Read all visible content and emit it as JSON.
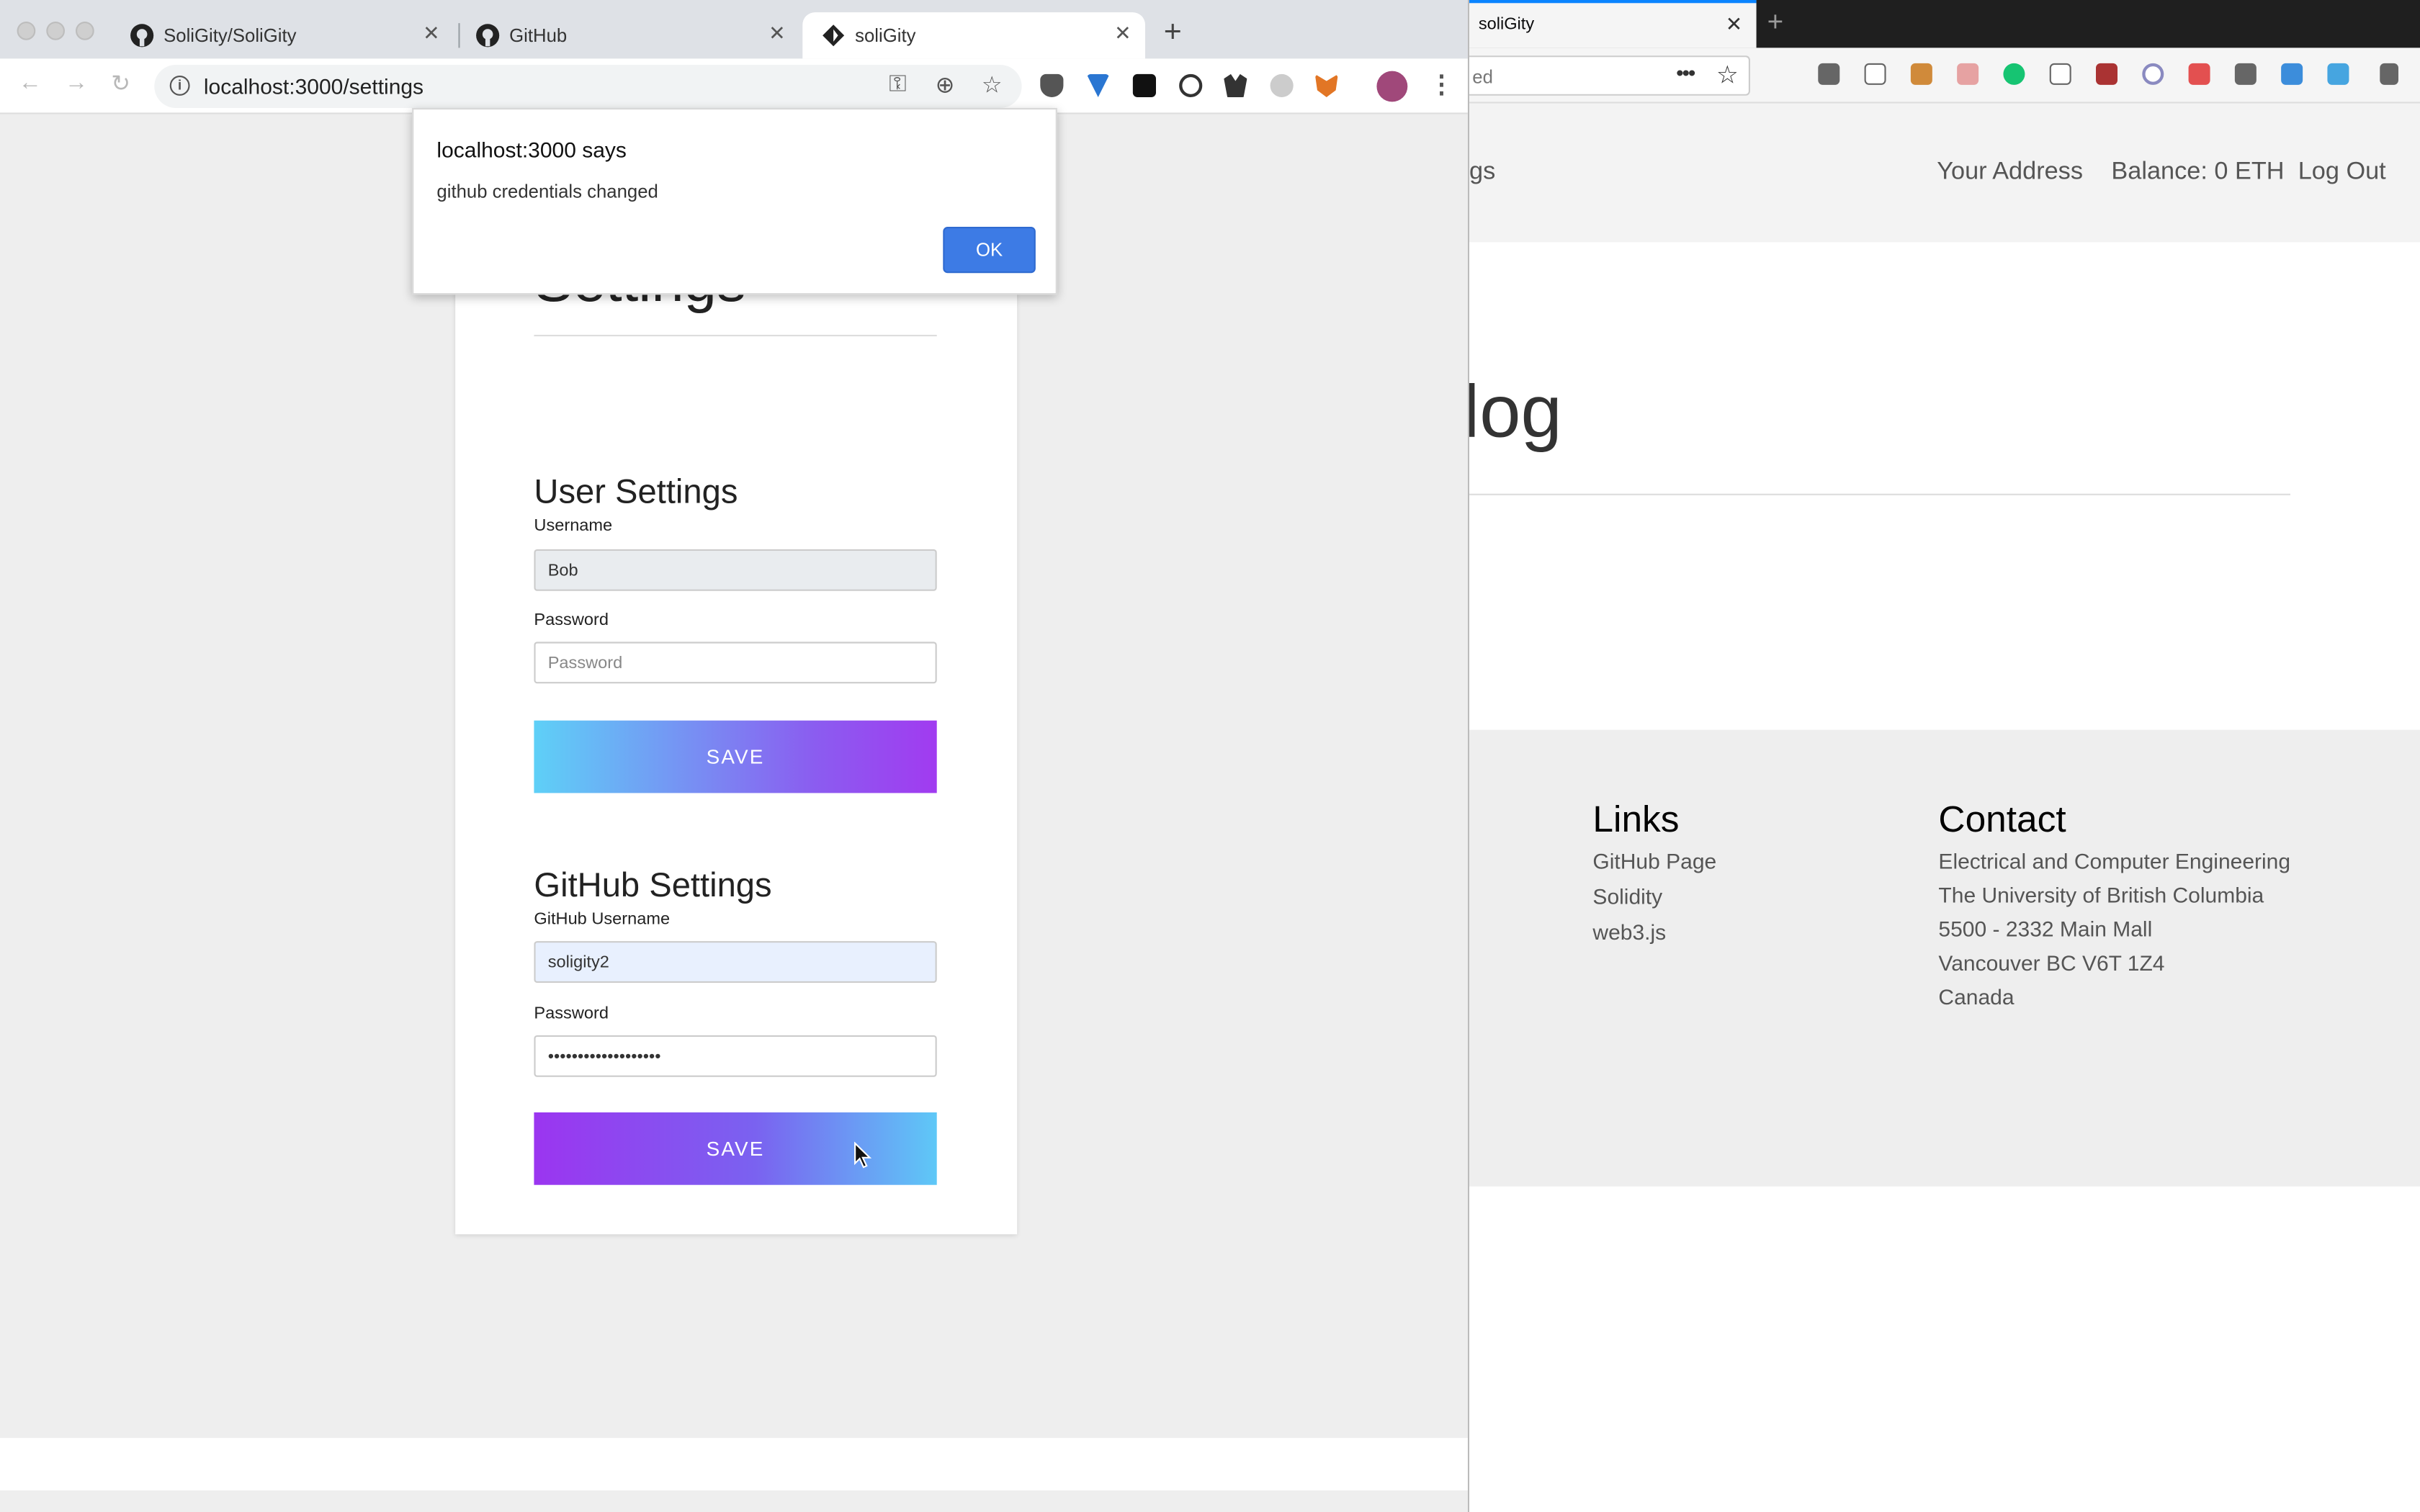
{
  "chrome": {
    "tabs": [
      {
        "title": "SoliGity/SoliGity",
        "icon": "github-icon",
        "active": false
      },
      {
        "title": "GitHub",
        "icon": "github-icon",
        "active": false
      },
      {
        "title": "soliGity",
        "icon": "soligity-icon",
        "active": true
      }
    ],
    "new_tab": "+",
    "url": "localhost:3000/settings",
    "info_icon": "i"
  },
  "alert": {
    "title": "localhost:3000 says",
    "message": "github credentials changed",
    "ok_label": "OK"
  },
  "settings": {
    "title": "Settings",
    "user_section": {
      "heading": "User Settings",
      "username_label": "Username",
      "username_value": "Bob",
      "password_label": "Password",
      "password_placeholder": "Password",
      "save_label": "SAVE"
    },
    "github_section": {
      "heading": "GitHub Settings",
      "username_label": "GitHub Username",
      "username_value": "soligity2",
      "password_label": "Password",
      "password_value": "•••••••••••••••••••",
      "save_label": "SAVE"
    }
  },
  "firefox": {
    "tab_title": "soliGity",
    "close": "✕",
    "new_tab": "+",
    "url_fragment": "ed",
    "nav": {
      "fragment": "gs",
      "your_address": "Your Address",
      "balance": "Balance: 0 ETH",
      "logout": "Log Out"
    },
    "heading_fragment": "log",
    "footer": {
      "links_title": "Links",
      "links": [
        "GitHub Page",
        "Solidity",
        "web3.js"
      ],
      "contact_title": "Contact",
      "contact_lines": [
        "Electrical and Computer Engineering",
        "The University of British Columbia",
        "5500 - 2332 Main Mall",
        "Vancouver BC V6T 1Z4",
        "Canada"
      ]
    }
  },
  "colors": {
    "alert_ok": "#3d7be5",
    "gradient_cyan": "#5ed0f7",
    "gradient_purple": "#9b35f0"
  }
}
